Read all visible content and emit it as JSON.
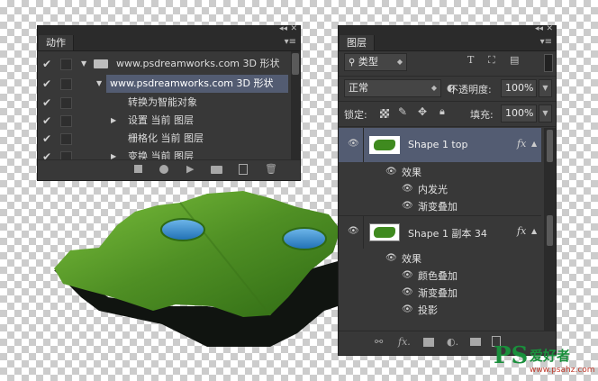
{
  "actions_panel": {
    "tab": "动作",
    "rows": [
      {
        "label": "www.psdreamworks.com 3D 形状"
      },
      {
        "label": "www.psdreamworks.com 3D 形状"
      },
      {
        "label": "转换为智能对象"
      },
      {
        "label": "设置 当前 图层"
      },
      {
        "label": "栅格化 当前 图层"
      },
      {
        "label": "变换 当前 图层"
      }
    ],
    "bottom_icons": [
      "stop-icon",
      "record-icon",
      "play-icon",
      "folder-icon",
      "new-action-icon",
      "delete-icon"
    ]
  },
  "layers_panel": {
    "tab": "图层",
    "filter_kind": "类型",
    "blend_mode": "正常",
    "opacity_label": "不透明度:",
    "opacity_value": "100%",
    "lock_label": "锁定:",
    "fill_label": "填充:",
    "fill_value": "100%",
    "fx_symbol": "fx",
    "layers": [
      {
        "name": "Shape 1 top",
        "effects_label": "效果",
        "effects": [
          "内发光",
          "渐变叠加"
        ]
      },
      {
        "name": "Shape 1 副本 34",
        "effects_label": "效果",
        "effects": [
          "颜色叠加",
          "渐变叠加",
          "投影"
        ]
      }
    ],
    "bottom_icons": [
      "link-icon",
      "fx-icon",
      "mask-icon",
      "adjustment-icon",
      "group-icon",
      "new-layer-icon",
      "delete-icon"
    ]
  },
  "watermark": {
    "brand": "PS",
    "text": "爱好者",
    "url": "www.psahz.com"
  },
  "colors": {
    "panel": "#383838",
    "dark": "#2b2b2b",
    "highlight": "#535c72",
    "grass": "#4f8f24",
    "water": "#3d8fd0"
  }
}
